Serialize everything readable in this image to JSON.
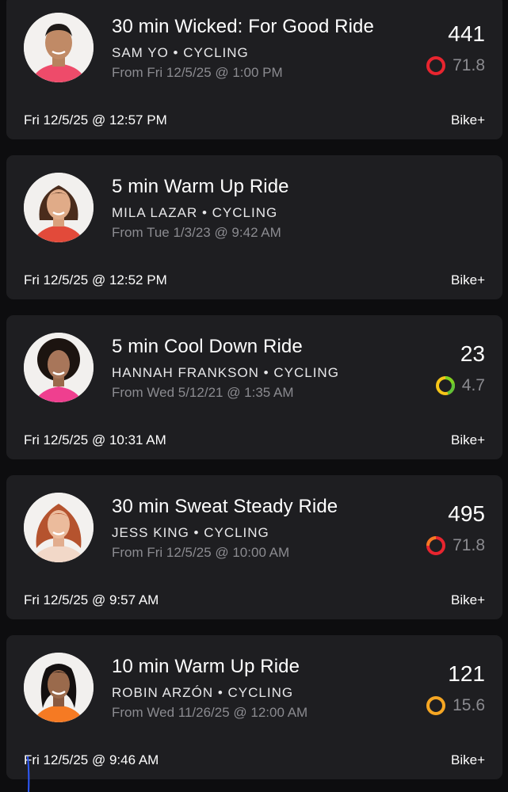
{
  "workouts": [
    {
      "title": "30 min Wicked: For Good Ride",
      "instructor": "SAM YO • CYCLING",
      "from": "From Fri 12/5/25 @ 1:00 PM",
      "output": "441",
      "strive_score": "71.8",
      "strive_color": "#e8252f",
      "date": "Fri 12/5/25 @ 12:57 PM",
      "device": "Bike+"
    },
    {
      "title": "5 min Warm Up Ride",
      "instructor": "MILA LAZAR • CYCLING",
      "from": "From Tue 1/3/23 @ 9:42 AM",
      "output": "",
      "strive_score": "",
      "date": "Fri 12/5/25 @ 12:52 PM",
      "device": "Bike+"
    },
    {
      "title": "5 min Cool Down Ride",
      "instructor": "HANNAH FRANKSON • CYCLING",
      "from": "From Wed 5/12/21 @ 1:35 AM",
      "output": "23",
      "strive_score": "4.7",
      "strive_color": "#f5c518",
      "date": "Fri 12/5/25 @ 10:31 AM",
      "device": "Bike+"
    },
    {
      "title": "30 min Sweat Steady Ride",
      "instructor": "JESS KING • CYCLING",
      "from": "From Fri 12/5/25 @ 10:00 AM",
      "output": "495",
      "strive_score": "71.8",
      "strive_color": "#e8252f",
      "date": "Fri 12/5/25 @ 9:57 AM",
      "device": "Bike+"
    },
    {
      "title": "10 min Warm Up Ride",
      "instructor": "ROBIN ARZÓN • CYCLING",
      "from": "From Wed 11/26/25 @ 12:00 AM",
      "output": "121",
      "strive_score": "15.6",
      "strive_color": "#f5a623",
      "date": "Fri 12/5/25 @ 9:46 AM",
      "device": "Bike+"
    }
  ]
}
